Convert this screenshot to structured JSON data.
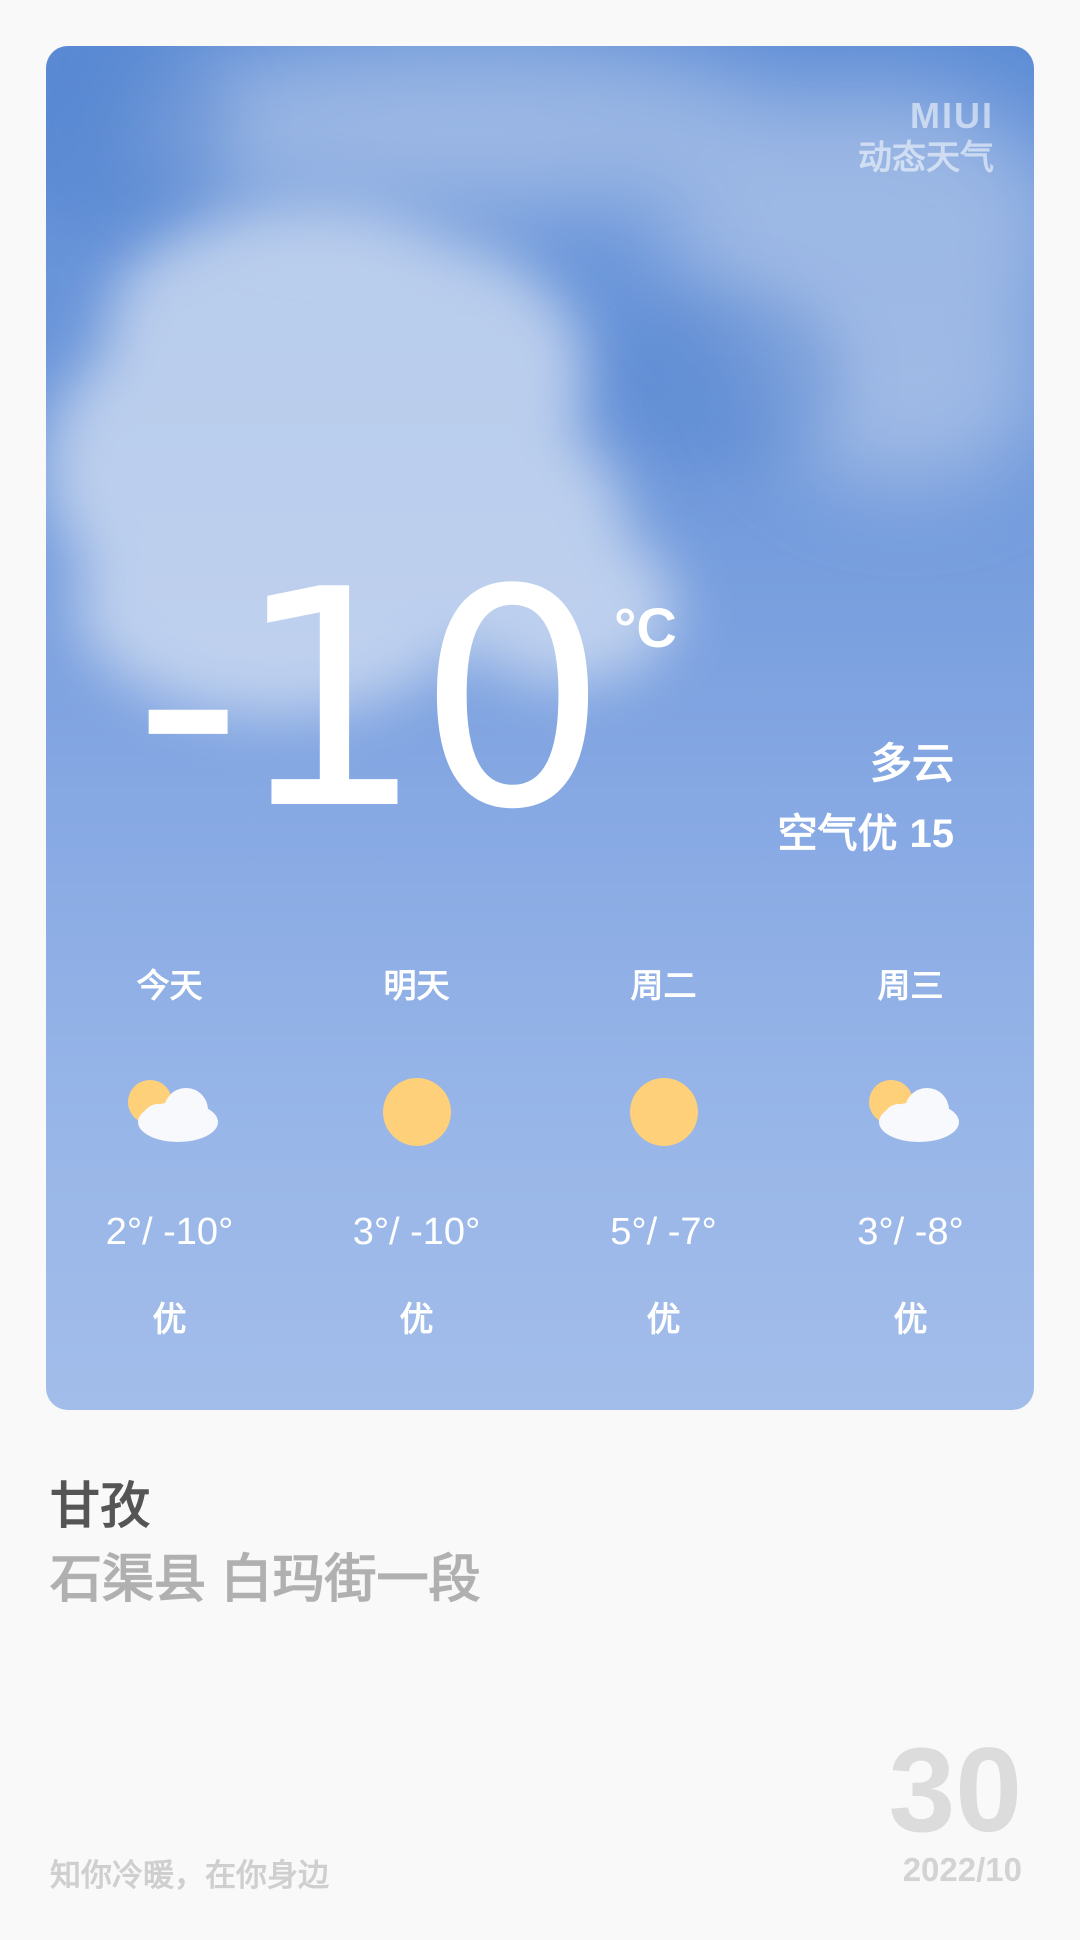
{
  "brand": {
    "logo": "MIUI",
    "subtitle": "动态天气"
  },
  "current": {
    "temperature": "-10",
    "unit": "°C",
    "condition": "多云",
    "aqi_label": "空气优",
    "aqi_value": "15"
  },
  "forecast": [
    {
      "day": "今天",
      "icon": "partly-cloudy-icon",
      "range": "2°/ -10°",
      "aqi": "优"
    },
    {
      "day": "明天",
      "icon": "sunny-icon",
      "range": "3°/ -10°",
      "aqi": "优"
    },
    {
      "day": "周二",
      "icon": "sunny-icon",
      "range": "5°/ -7°",
      "aqi": "优"
    },
    {
      "day": "周三",
      "icon": "partly-cloudy-icon",
      "range": "3°/ -8°",
      "aqi": "优"
    }
  ],
  "location": {
    "region": "甘孜",
    "street": "石渠县 白玛街一段"
  },
  "footer": {
    "slogan": "知你冷暖，在你身边",
    "day": "30",
    "year_month": "2022/10"
  },
  "colors": {
    "sky_top": "#5e8dd6",
    "sky_bottom": "#a3bdea",
    "sun": "#ffd07a"
  }
}
